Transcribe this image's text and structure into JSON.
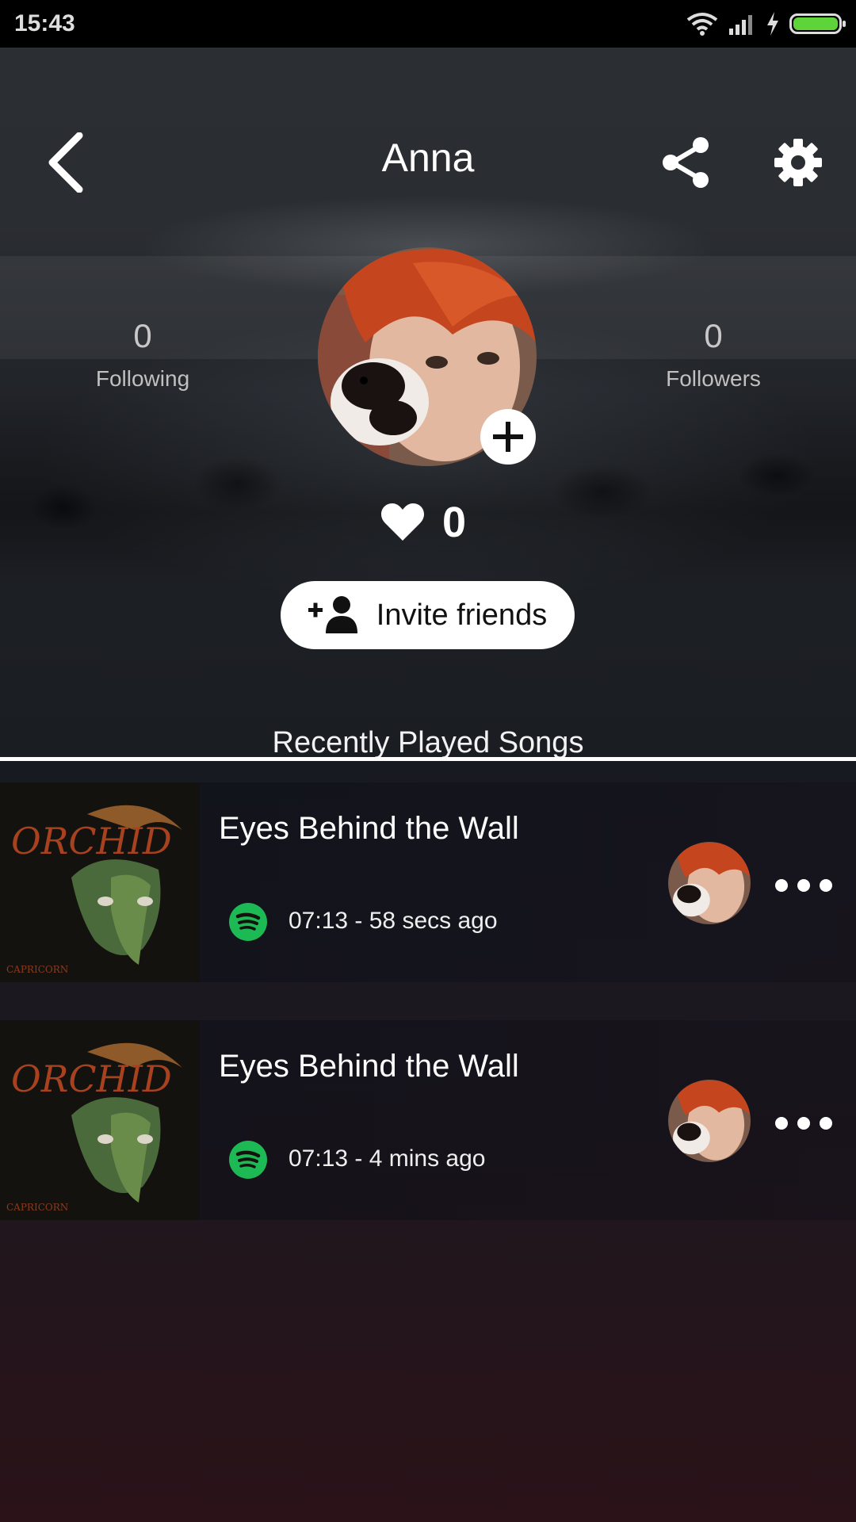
{
  "status_bar": {
    "time": "15:43"
  },
  "header": {
    "title": "Anna"
  },
  "stats": {
    "following_count": "0",
    "following_label": "Following",
    "followers_count": "0",
    "followers_label": "Followers"
  },
  "likes": {
    "count": "0"
  },
  "invite": {
    "label": "Invite friends"
  },
  "section": {
    "title": "Recently Played Songs"
  },
  "songs": [
    {
      "title": "Eyes Behind the Wall",
      "meta": "07:13 - 58 secs ago",
      "album_text": "ORCHID",
      "album_sub": "CAPRICORN"
    },
    {
      "title": "Eyes Behind the Wall",
      "meta": "07:13 - 4 mins ago",
      "album_text": "ORCHID",
      "album_sub": "CAPRICORN"
    }
  ],
  "icons": {
    "back": "chevron-left-icon",
    "share": "share-icon",
    "settings": "gear-icon",
    "add": "plus-icon",
    "heart": "heart-icon",
    "add_friend": "user-plus-icon",
    "spotify": "spotify-icon",
    "more": "more-horizontal-icon"
  },
  "colors": {
    "spotify_green": "#1db954",
    "battery_green": "#5fd33a"
  }
}
